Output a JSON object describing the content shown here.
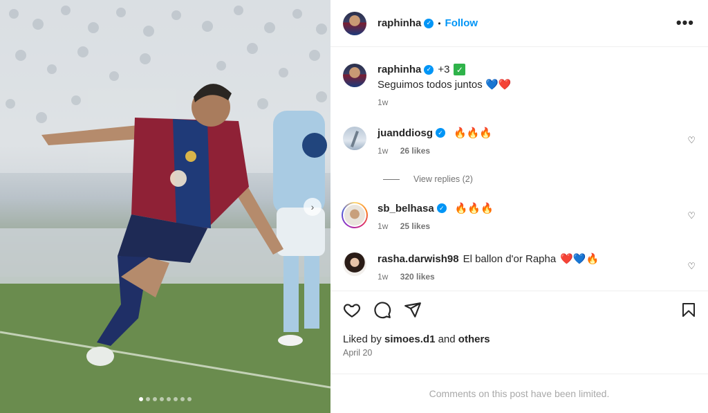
{
  "post": {
    "author": "raphinha",
    "follow_label": "Follow",
    "separator": "•",
    "more_label": "•••",
    "carousel_next": "›",
    "carousel": {
      "count": 8,
      "active_index": 0
    }
  },
  "caption": {
    "username": "raphinha",
    "extra": "+3",
    "check_emoji": "✓",
    "text": "Seguimos todos juntos",
    "hearts": "💙❤️",
    "time": "1w"
  },
  "comments": [
    {
      "username": "juanddiosg",
      "text": "",
      "emoji": "🔥🔥🔥",
      "time": "1w",
      "likes": "26 likes",
      "like_icon": "heart-outline-icon"
    },
    {
      "username": "sb_belhasa",
      "text": "",
      "emoji": "🔥🔥🔥",
      "time": "1w",
      "likes": "25 likes",
      "like_icon": "heart-outline-icon"
    },
    {
      "username": "rasha.darwish98",
      "text": "El ballon d'or Rapha",
      "emoji": "❤️💙🔥",
      "time": "1w",
      "likes": "320 likes",
      "like_icon": "heart-outline-icon"
    }
  ],
  "view_replies": "View replies (2)",
  "actions": {
    "icons": [
      "heart-icon",
      "comment-icon",
      "share-icon",
      "bookmark-icon"
    ]
  },
  "liked_by": {
    "prefix": "Liked by ",
    "user": "simoes.d1",
    "middle": " and ",
    "others": "others"
  },
  "date": "April 20",
  "limited_text": "Comments on this post have been limited.",
  "colors": {
    "accent": "#0095f6",
    "muted": "#737373",
    "text": "#262626"
  }
}
